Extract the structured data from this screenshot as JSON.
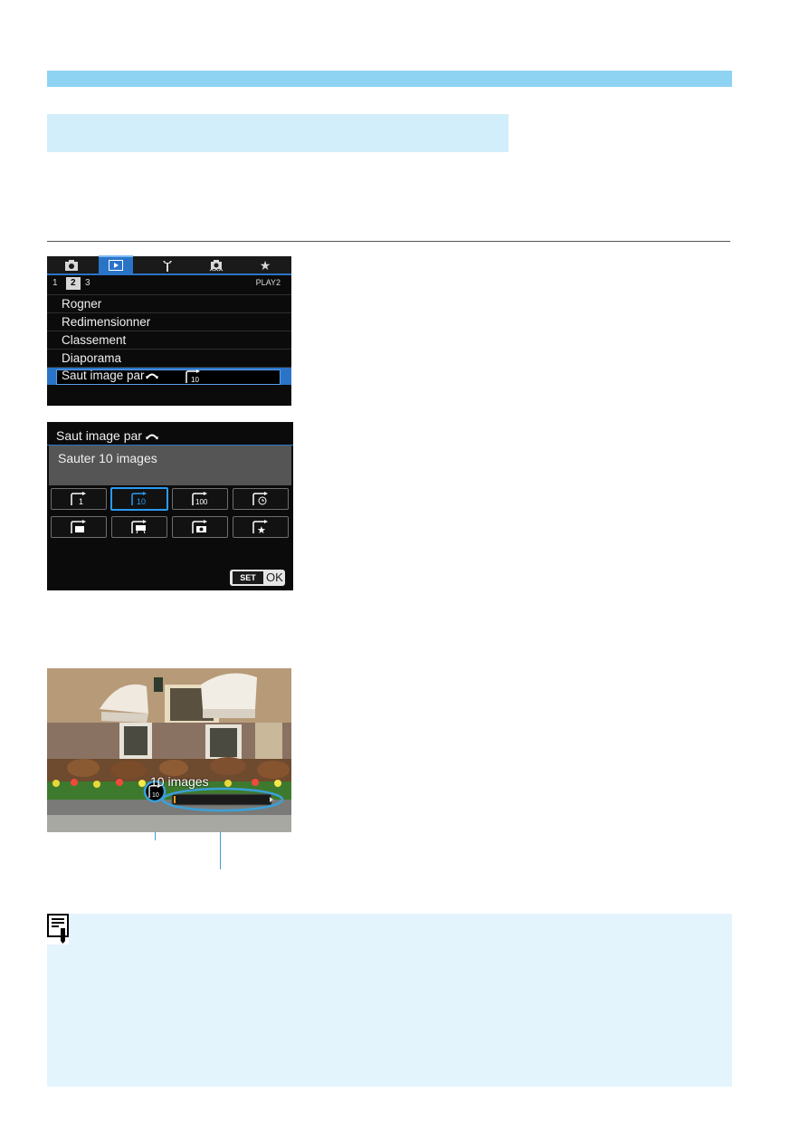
{
  "camera_menu": {
    "tabs": [
      {
        "icon": "camera-icon",
        "glyph": "■"
      },
      {
        "icon": "playback-icon",
        "glyph": "▶"
      },
      {
        "icon": "wrench-icon",
        "glyph": "⚒"
      },
      {
        "icon": "custom-camera-icon",
        "glyph": "■"
      },
      {
        "icon": "star-icon",
        "glyph": "★"
      }
    ],
    "subtabs": [
      "1",
      "2",
      "3"
    ],
    "play_label": "PLAY2",
    "items": [
      "Rogner",
      "Redimensionner",
      "Classement",
      "Diaporama",
      "Saut image par"
    ],
    "selected_value_icon": "jump-10-icon"
  },
  "jump_setting": {
    "title": "Saut image par",
    "description": "Sauter 10 images",
    "options": [
      {
        "icon": "jump-1-icon",
        "mark": "1"
      },
      {
        "icon": "jump-10-icon",
        "mark": "10"
      },
      {
        "icon": "jump-100-icon",
        "mark": "100"
      },
      {
        "icon": "jump-date-icon",
        "mark": ""
      },
      {
        "icon": "jump-folder-icon",
        "mark": ""
      },
      {
        "icon": "jump-movie-icon",
        "mark": ""
      },
      {
        "icon": "jump-still-icon",
        "mark": ""
      },
      {
        "icon": "jump-rating-icon",
        "mark": ""
      }
    ],
    "set_label": "SET",
    "ok_label": "OK"
  },
  "playback_photo": {
    "overlay_text": "10 images",
    "jump_icon": "jump-10-icon",
    "progress_fraction": 0.02
  },
  "colors": {
    "accent_blue": "#2a74c8",
    "selection_blue": "#2a9bf2",
    "header_bar": "#8fd3f3",
    "banner": "#d2eefb",
    "note_background": "#e4f4fd"
  },
  "note": {
    "icon": "memo-icon"
  }
}
